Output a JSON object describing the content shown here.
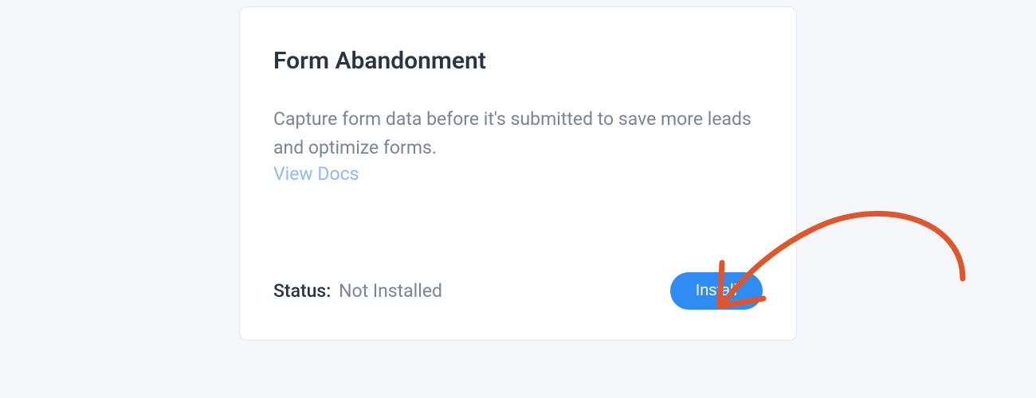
{
  "card": {
    "title": "Form Abandonment",
    "description": "Capture form data before it's submitted to save more leads and optimize forms.",
    "view_docs_label": "View Docs",
    "status_label": "Status:",
    "status_value": "Not Installed",
    "install_label": "Install"
  },
  "annotation": {
    "arrow_color": "#e0562c"
  }
}
